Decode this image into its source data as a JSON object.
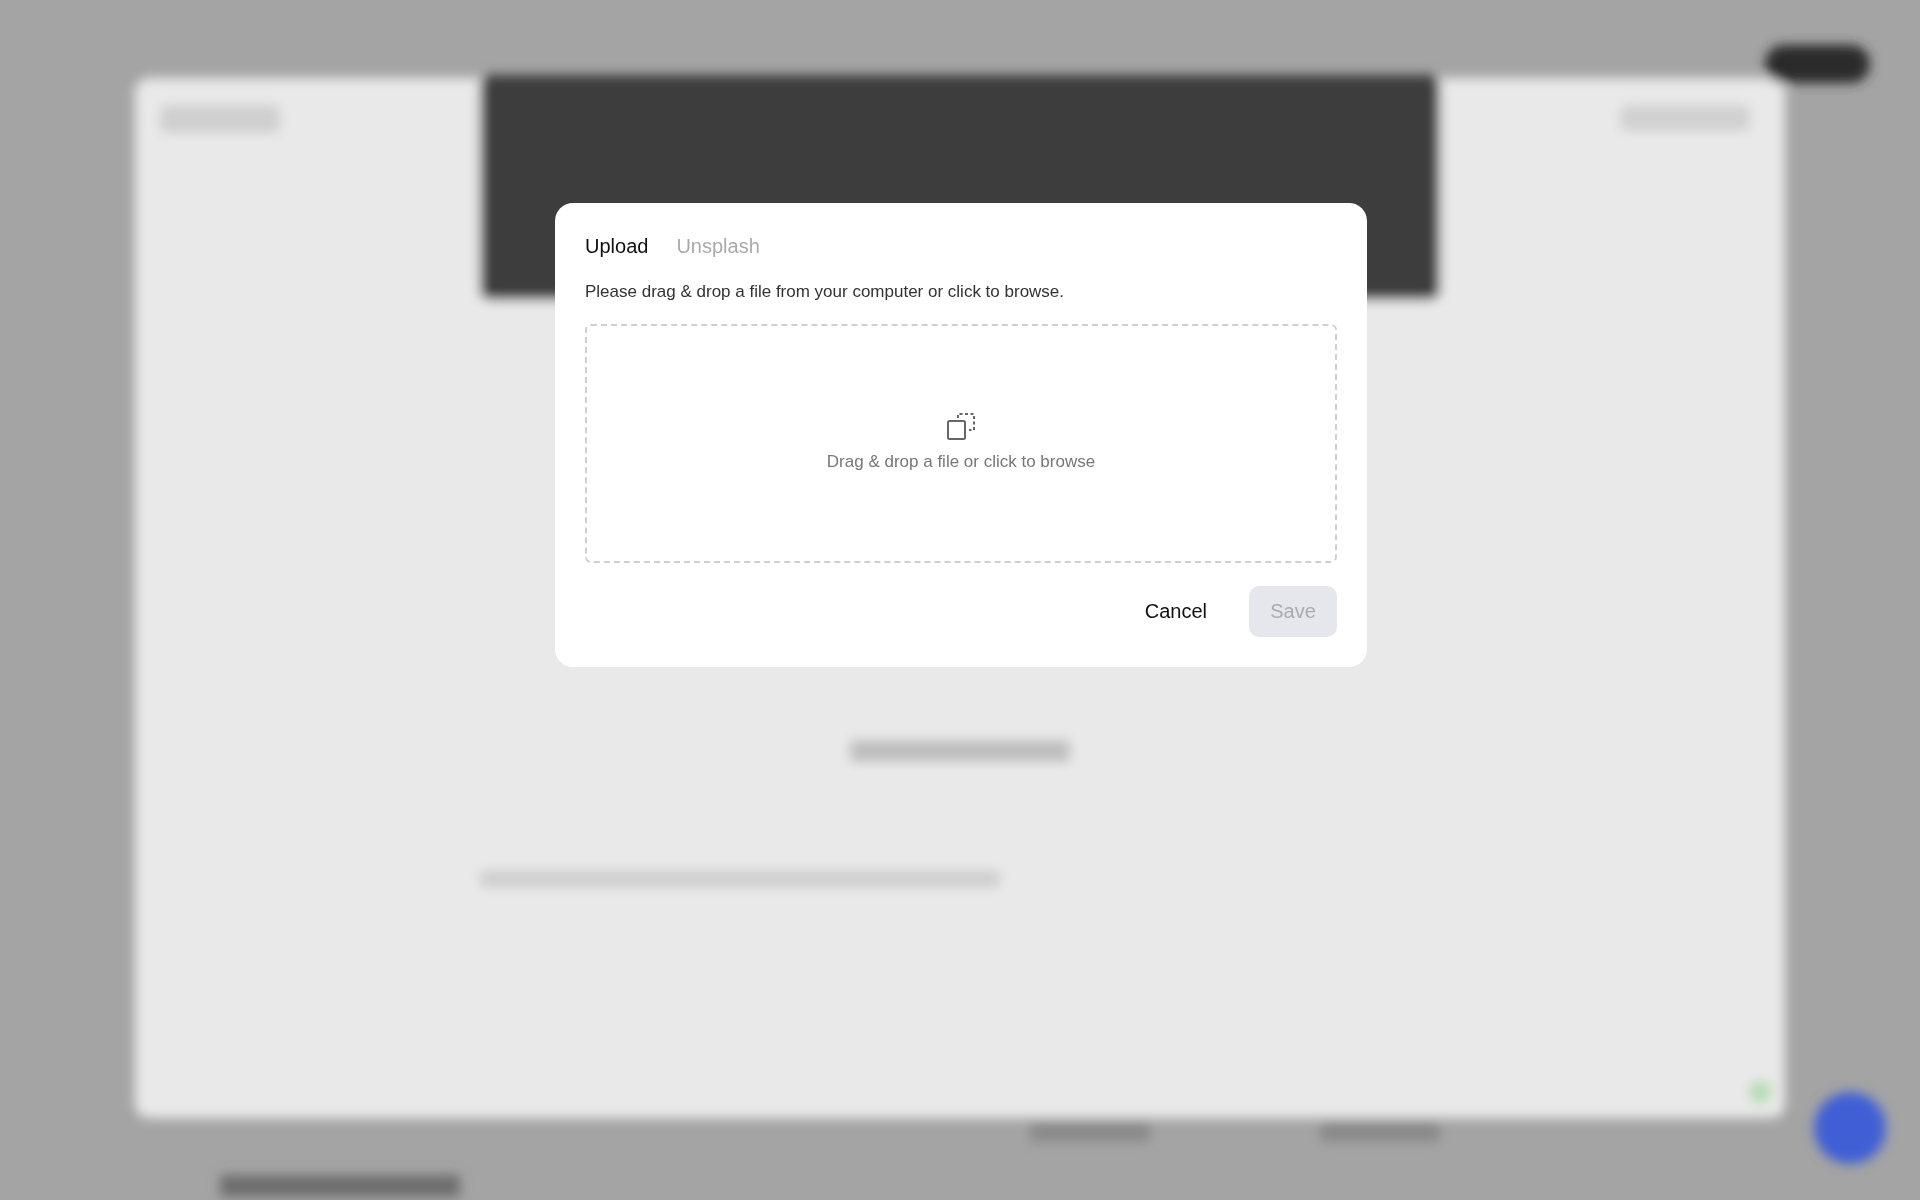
{
  "dialog": {
    "tabs": [
      {
        "label": "Upload",
        "selected": true
      },
      {
        "label": "Unsplash",
        "selected": false
      }
    ],
    "instructions": "Please drag & drop a file from your computer or click to browse.",
    "dropzone": {
      "label": "Drag & drop a file or click to browse"
    },
    "buttons": [
      {
        "label": "Cancel",
        "kind": "secondary",
        "disabled": false
      },
      {
        "label": "Save",
        "kind": "primary",
        "disabled": true
      }
    ]
  }
}
